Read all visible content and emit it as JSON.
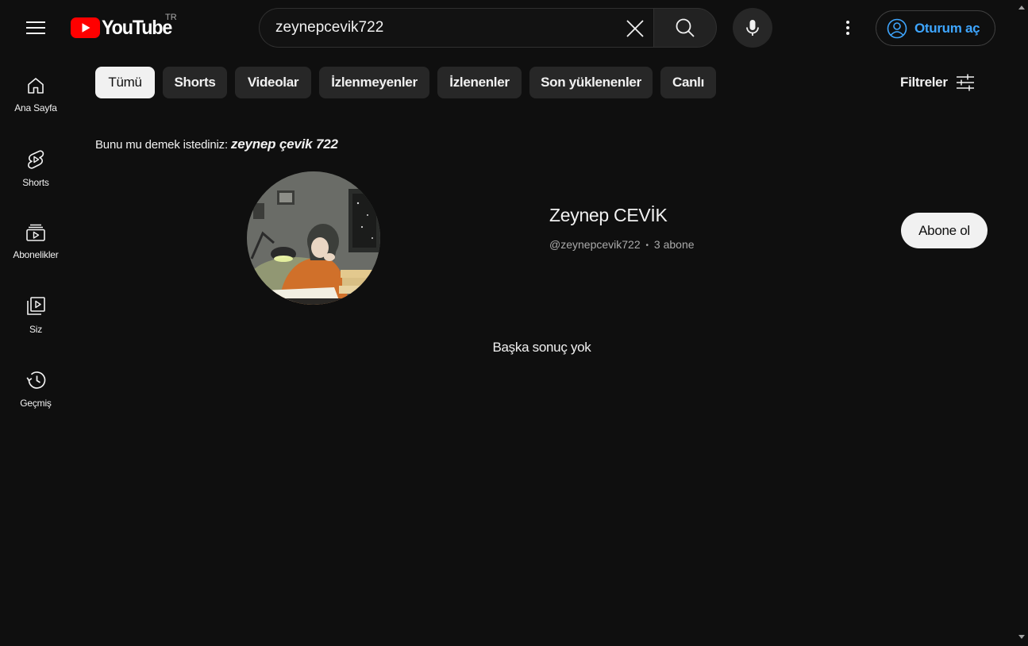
{
  "header": {
    "logo_text": "YouTube",
    "region": "TR",
    "search": {
      "value": "zeynepcevik722"
    },
    "signin_label": "Oturum aç"
  },
  "sidebar": {
    "items": [
      {
        "label": "Ana Sayfa",
        "icon": "home-icon"
      },
      {
        "label": "Shorts",
        "icon": "shorts-icon"
      },
      {
        "label": "Abonelikler",
        "icon": "subscriptions-icon"
      },
      {
        "label": "Siz",
        "icon": "you-library-icon"
      },
      {
        "label": "Geçmiş",
        "icon": "history-icon"
      }
    ]
  },
  "chips": [
    {
      "label": "Tümü",
      "active": true
    },
    {
      "label": "Shorts"
    },
    {
      "label": "Videolar"
    },
    {
      "label": "İzlenmeyenler"
    },
    {
      "label": "İzlenenler"
    },
    {
      "label": "Son yüklenenler"
    },
    {
      "label": "Canlı"
    }
  ],
  "filters_label": "Filtreler",
  "suggestion": {
    "prefix": "Bunu mu demek istediniz:",
    "query": "zeynep çevik 722"
  },
  "channel": {
    "name": "Zeynep CEVİK",
    "handle": "@zeynepcevik722",
    "separator": "•",
    "subscribers": "3 abone",
    "subscribe_label": "Abone ol"
  },
  "no_more_results": "Başka sonuç yok",
  "colors": {
    "background": "#0f0f0f",
    "accent_link": "#3ea6ff",
    "brand_red": "#ff0000",
    "chip_bg": "#272727",
    "chip_active_bg": "#f1f1f1"
  }
}
